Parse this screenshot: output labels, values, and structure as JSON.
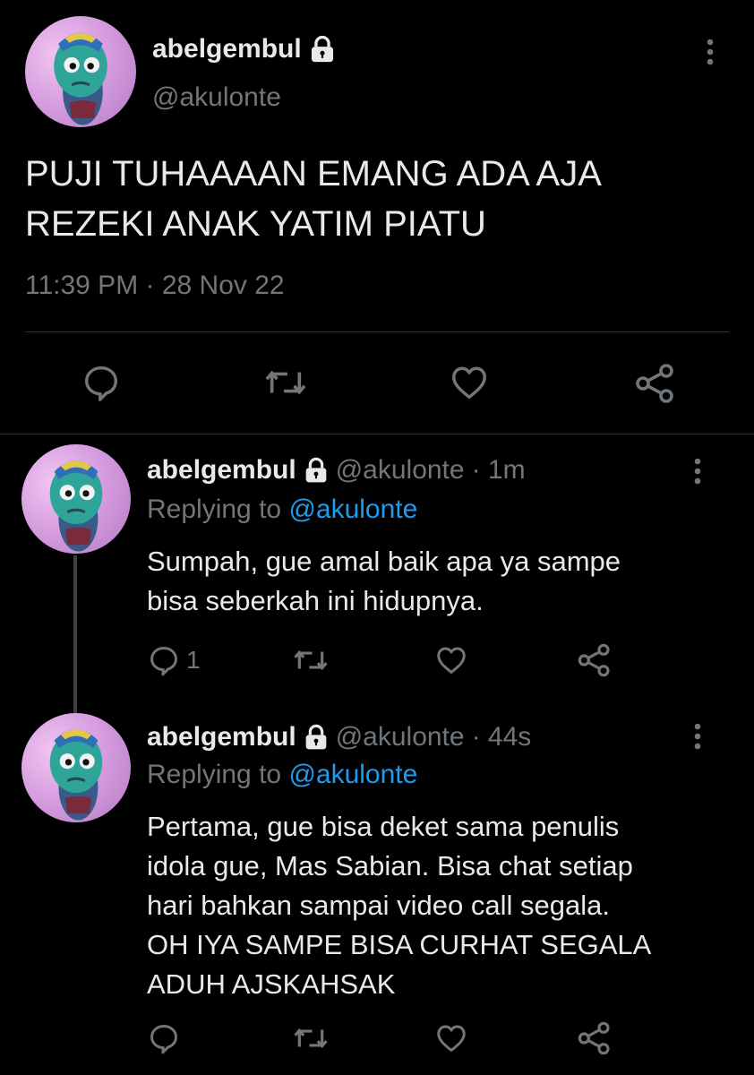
{
  "main_tweet": {
    "display_name": "abelgembul",
    "handle": "@akulonte",
    "text_line1": "PUJI TUHAAAAN EMANG ADA AJA",
    "text_line2": "REZEKI ANAK YATIM PIATU",
    "timestamp": "11:39 PM · 28 Nov 22",
    "actions": [
      "reply-icon",
      "retweet-icon",
      "like-icon",
      "share-icon"
    ]
  },
  "replies": [
    {
      "display_name": "abelgembul",
      "handle": "@akulonte",
      "time": "· 1m",
      "replying_prefix": "Replying to ",
      "replying_to": "@akulonte",
      "text_lines": [
        "Sumpah, gue amal baik apa ya sampe",
        "bisa seberkah ini hidupnya."
      ],
      "reply_count": "1"
    },
    {
      "display_name": "abelgembul",
      "handle": "@akulonte",
      "time": "· 44s",
      "replying_prefix": "Replying to ",
      "replying_to": "@akulonte",
      "text_lines": [
        "Pertama, gue bisa deket sama penulis",
        "idola gue, Mas Sabian. Bisa chat setiap",
        "hari bahkan sampai video call segala.",
        "OH IYA SAMPE BISA CURHAT SEGALA",
        "ADUH AJSKAHSAK"
      ],
      "reply_count": ""
    }
  ],
  "colors": {
    "background": "#000000",
    "text": "#e7e9ea",
    "muted": "#71767b",
    "link": "#1d9bf0",
    "divider": "#2f3336"
  }
}
